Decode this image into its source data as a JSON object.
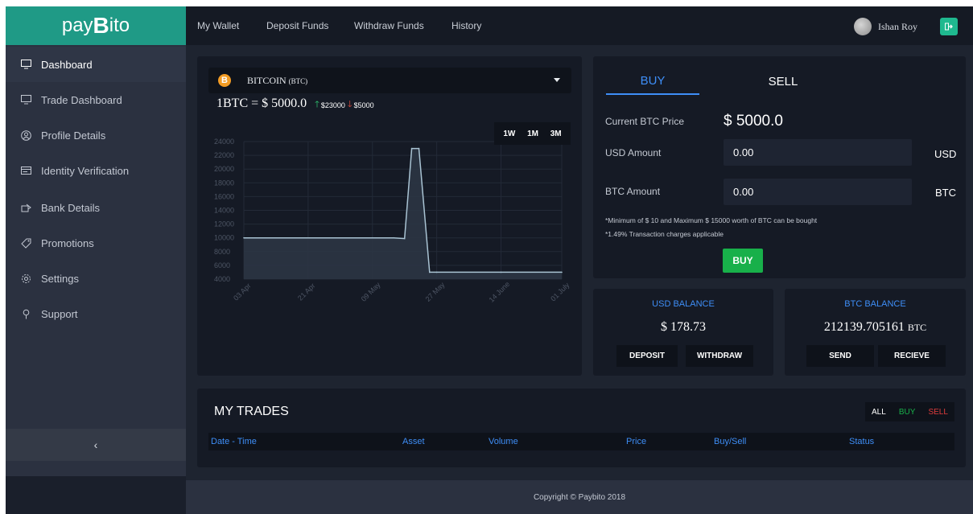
{
  "app": {
    "logo_prefix": "pay",
    "logo_b": "B",
    "logo_suffix": "ito"
  },
  "sidebar": {
    "items": [
      {
        "label": "Dashboard",
        "icon": "monitor-icon"
      },
      {
        "label": "Trade Dashboard",
        "icon": "monitor-icon"
      },
      {
        "label": "Profile Details",
        "icon": "profile-icon"
      },
      {
        "label": "Identity Verification",
        "icon": "id-card-icon"
      },
      {
        "label": "Bank Details",
        "icon": "bank-icon"
      },
      {
        "label": "Promotions",
        "icon": "tag-icon"
      },
      {
        "label": "Settings",
        "icon": "gear-icon"
      },
      {
        "label": "Support",
        "icon": "support-icon"
      }
    ],
    "collapse_glyph": "‹"
  },
  "topbar": {
    "links": [
      "My Wallet",
      "Deposit Funds",
      "Withdraw Funds",
      "History"
    ],
    "user_name": "Ishan Roy"
  },
  "coin": {
    "name": "BITCOIN",
    "symbol": "(BTC)",
    "price_text": "1BTC = $ 5000.0",
    "high": "$23000",
    "low": "$5000",
    "ranges": [
      "1W",
      "1M",
      "3M"
    ]
  },
  "chart_data": {
    "type": "area",
    "x": [
      "03 Apr",
      "21 Apr",
      "09 May",
      "27 May",
      "14 June",
      "01 July"
    ],
    "y_ticks": [
      4000,
      6000,
      8000,
      10000,
      12000,
      14000,
      16000,
      18000,
      20000,
      22000,
      24000
    ],
    "ylim": [
      4000,
      24000
    ],
    "grid": true,
    "series": [
      {
        "points": [
          [
            "03 Apr",
            10000
          ],
          [
            "21 Apr",
            10000
          ],
          [
            "09 May",
            10000
          ],
          [
            "15 May",
            10000
          ],
          [
            "18 May",
            9900
          ],
          [
            "20 May",
            23000
          ],
          [
            "22 May",
            23000
          ],
          [
            "25 May",
            5000
          ],
          [
            "27 May",
            5000
          ],
          [
            "14 June",
            5000
          ],
          [
            "01 July",
            5000
          ]
        ]
      }
    ]
  },
  "trade": {
    "buy_tab": "BUY",
    "sell_tab": "SELL",
    "current_price_label": "Current BTC Price",
    "current_price": "$ 5000.0",
    "usd_label": "USD Amount",
    "usd_value": "0.00",
    "usd_unit": "USD",
    "btc_label": "BTC Amount",
    "btc_value": "0.00",
    "btc_unit": "BTC",
    "note1": "*Minimum of $ 10 and Maximum $ 15000 worth of BTC can be bought",
    "note2": "*1.49% Transaction charges applicable",
    "buy_button": "BUY"
  },
  "usd_balance": {
    "title": "USD BALANCE",
    "value": "$ 178.73",
    "deposit": "DEPOSIT",
    "withdraw": "WITHDRAW"
  },
  "btc_balance": {
    "title": "BTC BALANCE",
    "value": "212139.705161",
    "unit": "BTC",
    "send": "SEND",
    "receive": "RECIEVE"
  },
  "trades": {
    "title": "MY TRADES",
    "filters": [
      "ALL",
      "BUY",
      "SELL"
    ],
    "columns": [
      "Date - Time",
      "Asset",
      "Volume",
      "Price",
      "Buy/Sell",
      "Status"
    ]
  },
  "footer": {
    "text": "Copyright © Paybito 2018"
  },
  "colors": {
    "brand": "#1f9a86",
    "accent": "#3e8ef7",
    "buy_green": "#18b04a",
    "sell_red": "#e03c3c",
    "line": "#a9c3d3"
  }
}
